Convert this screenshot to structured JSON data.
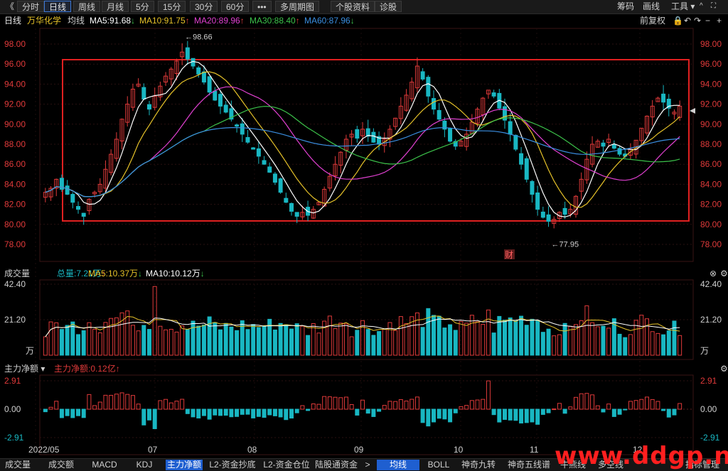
{
  "toolbar": {
    "back_glyph": "《",
    "tabs": [
      "分时",
      "日线",
      "周线",
      "月线",
      "5分",
      "15分",
      "30分",
      "60分",
      "•••",
      "多周期图",
      "个股资料",
      "诊股"
    ],
    "active_tab": "日线",
    "right": [
      "筹码",
      "画线",
      "工具 ▾"
    ],
    "win_buttons": [
      "^",
      "∨"
    ]
  },
  "infobar": {
    "period": "日线",
    "stock_name": "万华化学",
    "avg_label": "均线",
    "ma5": "MA5:91.68",
    "ma10": "MA10:91.75",
    "ma20": "MA20:89.96",
    "ma30": "MA30:88.40",
    "ma60": "MA60:87.96",
    "ma5_arrow": "↓",
    "ma10_arrow": "↑",
    "ma20_arrow": "↑",
    "ma30_arrow": "↑",
    "ma60_arrow": "↓",
    "adjust": "前复权",
    "right_icons": [
      "lock-icon",
      "undo-icon",
      "redo-icon",
      "zoom-out-icon",
      "zoom-in-icon"
    ]
  },
  "price_axis": {
    "ticks": [
      "98.00",
      "96.00",
      "94.00",
      "92.00",
      "90.00",
      "88.00",
      "86.00",
      "84.00",
      "82.00",
      "80.00",
      "78.00"
    ],
    "high_label": "98.66",
    "low_label": "77.95",
    "event_badge": "财"
  },
  "volume_panel": {
    "title": "成交量",
    "total": "总量:7.21万",
    "total_arrow": "↑",
    "ma5": "MA5:10.37万",
    "ma5_arrow": "↓",
    "ma10": "MA10:10.12万",
    "ma10_arrow": "↓",
    "ticks": [
      "42.40",
      "21.20",
      "万"
    ]
  },
  "flow_panel": {
    "title": "主力净额 ▾",
    "value": "主力净额:0.12亿",
    "value_arrow": "↑",
    "ticks": [
      "2.91",
      "0.00",
      "-2.91"
    ]
  },
  "date_axis": [
    "2022/05",
    "07",
    "08",
    "09",
    "10",
    "11",
    "12"
  ],
  "bottom_tabs": [
    "成交量",
    "成交额",
    "MACD",
    "KDJ",
    "主力净额",
    "L2-资金抄底",
    "L2-资金仓位",
    "陆股通资金",
    ">",
    "均线",
    "BOLL",
    "神奇九转",
    "神奇五线谱",
    "牛熊线",
    "多空线",
    "指标管理"
  ],
  "active_bottom_tab": "主力净额",
  "active_overlay_tab": "均线",
  "watermark": "www.ddgp.net",
  "colors": {
    "up": "#e03a3a",
    "down": "#19b7c2",
    "ma5": "#ffffff",
    "ma10": "#e6c229",
    "ma20": "#e040d0",
    "ma30": "#3cc24a",
    "ma60": "#3a8ee0",
    "highlight_box": "#e02020"
  },
  "chart_data": {
    "type": "candlestick",
    "x_range": [
      "2022/05",
      "12"
    ],
    "ylim": [
      77.0,
      99.0
    ],
    "grid": true,
    "notable": {
      "high": 98.66,
      "low": 77.95
    },
    "price_series_desc": "daily candles rising from ~83 in May to peak 98.66 in early July, falling to ~80.5 in early Aug, recovering to ~96 in Sept, dropping to 77.95 in early Nov, recovering to ~92 in Dec",
    "close_path": [
      83.2,
      83.6,
      84.5,
      83.5,
      83.0,
      82.2,
      81.5,
      80.8,
      82.5,
      83.2,
      84.0,
      85.5,
      87.0,
      88.5,
      90.5,
      92.0,
      93.5,
      94.0,
      92.5,
      91.5,
      92.8,
      93.8,
      94.8,
      95.5,
      96.3,
      97.2,
      96.5,
      95.8,
      95.0,
      94.2,
      93.2,
      92.4,
      91.8,
      91.2,
      90.5,
      89.8,
      89.0,
      88.2,
      87.5,
      86.8,
      86.0,
      85.2,
      84.2,
      83.2,
      82.2,
      81.3,
      80.8,
      81.2,
      80.9,
      81.5,
      82.2,
      83.5,
      84.8,
      86.0,
      87.2,
      88.5,
      89.0,
      88.6,
      89.5,
      88.8,
      88.2,
      88.0,
      88.5,
      89.5,
      90.6,
      91.8,
      92.9,
      94.2,
      95.8,
      94.5,
      92.8,
      91.5,
      90.5,
      89.5,
      88.3,
      87.8,
      88.3,
      89.0,
      90.2,
      91.5,
      92.6,
      93.4,
      92.8,
      91.6,
      90.4,
      89.0,
      87.5,
      86.0,
      84.5,
      83.0,
      81.5,
      80.7,
      80.3,
      80.5,
      81.2,
      81.0,
      81.5,
      82.8,
      84.5,
      86.5,
      88.0,
      88.3,
      87.8,
      88.5,
      87.6,
      87.0,
      86.8,
      87.5,
      88.4,
      89.6,
      90.8,
      91.8,
      92.6,
      92.2,
      91.6,
      91.2,
      91.8
    ]
  }
}
